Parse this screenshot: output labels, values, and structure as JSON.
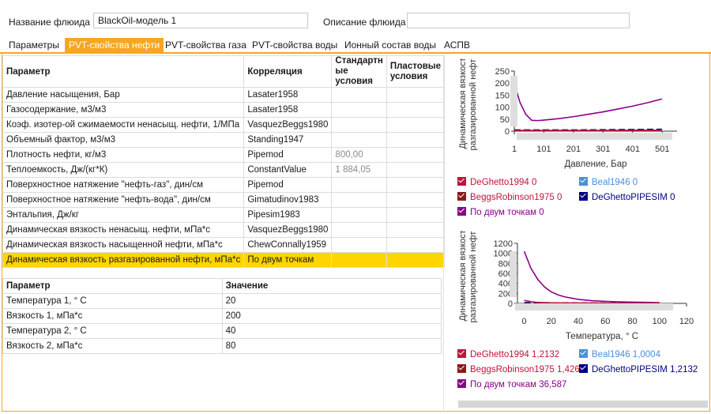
{
  "header": {
    "fluid_name_label": "Название флюида",
    "fluid_name_value": "BlackOil-модель 1",
    "fluid_desc_label": "Описание флюида",
    "fluid_desc_value": ""
  },
  "tabs": [
    "Параметры",
    "PVT-свойства нефти",
    "PVT-свойства газа",
    "PVT-свойства воды",
    "Ионный состав воды",
    "АСПВ"
  ],
  "corr_table": {
    "headers": {
      "param": "Параметр",
      "corr": "Корреляция",
      "std": "Стандартн ые условия",
      "res": "Пластовые условия"
    },
    "rows": [
      {
        "param": "Давление насыщения, Бар",
        "corr": "Lasater1958",
        "std": "",
        "res": ""
      },
      {
        "param": "Газосодержание, м3/м3",
        "corr": "Lasater1958",
        "std": "",
        "res": ""
      },
      {
        "param": "Коэф. изотер-ой сжимаемости ненасыщ. нефти, 1/МПа",
        "corr": "VasquezBeggs1980",
        "std": "",
        "res": ""
      },
      {
        "param": "Объемный фактор, м3/м3",
        "corr": "Standing1947",
        "std": "",
        "res": ""
      },
      {
        "param": "Плотность нефти, кг/м3",
        "corr": "Pipemod",
        "std": "800,00",
        "res": ""
      },
      {
        "param": "Теплоемкость, Дж/(кг*К)",
        "corr": "ConstantValue",
        "std": "1 884,05",
        "res": ""
      },
      {
        "param": "Поверхностное натяжение \"нефть-газ\", дин/см",
        "corr": "Pipemod",
        "std": "",
        "res": ""
      },
      {
        "param": "Поверхностное натяжение \"нефть-вода\", дин/см",
        "corr": "Gimatudinov1983",
        "std": "",
        "res": ""
      },
      {
        "param": "Энтальпия, Дж/кг",
        "corr": "Pipesim1983",
        "std": "",
        "res": ""
      },
      {
        "param": "Динамическая вязкость ненасыщ. нефти, мПа*с",
        "corr": "VasquezBeggs1980",
        "std": "",
        "res": ""
      },
      {
        "param": "Динамическая вязкость насыщенной нефти, мПа*с",
        "corr": "ChewConnally1959",
        "std": "",
        "res": ""
      },
      {
        "param": "Динамическая вязкость разгазированной нефти, мПа*с",
        "corr": "По двум точкам",
        "std": "",
        "res": ""
      }
    ]
  },
  "value_table": {
    "headers": {
      "param": "Параметр",
      "value": "Значение"
    },
    "rows": [
      {
        "param": "Температура 1, ° C",
        "value": "20"
      },
      {
        "param": "Вязкость 1, мПа*с",
        "value": "200"
      },
      {
        "param": "Температура 2, ° C",
        "value": "40"
      },
      {
        "param": "Вязкость 2, мПа*с",
        "value": "80"
      }
    ]
  },
  "colors": {
    "accent": "#f5a623",
    "highlight": "#ffd500",
    "deghetto": "#c0143c",
    "beggs": "#8b1a1a",
    "beal": "#4a90d9",
    "pipesim": "#000080",
    "two_points": "#8b008b"
  },
  "chart_data": [
    {
      "type": "line",
      "ylabel": "Динамическая вязкость разгазированной нефти,",
      "xlabel": "Давление, Бар",
      "xticks": [
        "1",
        "101",
        "201",
        "301",
        "401",
        "501"
      ],
      "yticks": [
        "0",
        "50",
        "100",
        "150",
        "200",
        "250"
      ],
      "xlim": [
        1,
        551
      ],
      "ylim": [
        0,
        250
      ],
      "series": [
        {
          "name": "По двум точкам",
          "color": "#8b008b",
          "dash": false,
          "x": [
            1,
            20,
            40,
            60,
            80,
            100,
            150,
            200,
            250,
            300,
            350,
            400,
            450,
            500
          ],
          "y": [
            200,
            120,
            70,
            45,
            44,
            46,
            52,
            60,
            70,
            80,
            92,
            104,
            118,
            134
          ]
        },
        {
          "name": "DeGhettoPIPESIM",
          "color": "#000080",
          "dash": true,
          "x": [
            1,
            100,
            200,
            300,
            400,
            500
          ],
          "y": [
            5,
            5,
            5,
            6,
            7,
            8
          ]
        },
        {
          "name": "DeGhetto1994",
          "color": "#c0143c",
          "dash": false,
          "x": [
            1,
            100,
            200,
            300,
            400,
            500
          ],
          "y": [
            3,
            3,
            3,
            3,
            4,
            4
          ]
        }
      ],
      "legend": [
        {
          "name": "DeGhetto1994",
          "value": "0",
          "color": "#c0143c",
          "text_color": "#c0143c"
        },
        {
          "name": "Beal1946",
          "value": "0",
          "color": "#4a90d9",
          "text_color": "#4a90d9"
        },
        {
          "name": "BeggsRobinson1975",
          "value": "0",
          "color": "#8b1a1a",
          "text_color": "#c0143c"
        },
        {
          "name": "DeGhettoPIPESIM",
          "value": "0",
          "color": "#000080",
          "text_color": "#000080"
        },
        {
          "name": "По двум точкам",
          "value": "0",
          "color": "#8b008b",
          "text_color": "#8b008b"
        }
      ]
    },
    {
      "type": "line",
      "ylabel": "Динамическая вязкость разгазированной нефти,",
      "xlabel": "Температура, ° С",
      "xticks": [
        "0",
        "20",
        "40",
        "60",
        "80",
        "100",
        "120"
      ],
      "yticks": [
        "0",
        "200",
        "400",
        "600",
        "800",
        "1000",
        "1200"
      ],
      "xlim": [
        -5,
        120
      ],
      "ylim": [
        0,
        1200
      ],
      "series": [
        {
          "name": "По двум точкам",
          "color": "#8b008b",
          "dash": false,
          "x": [
            0,
            5,
            10,
            15,
            20,
            25,
            30,
            40,
            50,
            60,
            70,
            80,
            90,
            100
          ],
          "y": [
            1040,
            700,
            480,
            330,
            230,
            170,
            130,
            80,
            55,
            40,
            30,
            25,
            20,
            15
          ]
        },
        {
          "name": "DeGhettoPIPESIM",
          "color": "#000080",
          "dash": true,
          "x": [
            0,
            20,
            40,
            60,
            80,
            100
          ],
          "y": [
            15,
            12,
            10,
            8,
            7,
            6
          ]
        },
        {
          "name": "DeGhetto1994",
          "color": "#c0143c",
          "dash": false,
          "x": [
            0,
            5,
            10,
            20,
            40,
            60,
            80,
            100
          ],
          "y": [
            60,
            35,
            20,
            12,
            8,
            6,
            5,
            5
          ]
        }
      ],
      "legend": [
        {
          "name": "DeGhetto1994",
          "value": "1,2132",
          "color": "#c0143c",
          "text_color": "#c0143c"
        },
        {
          "name": "Beal1946",
          "value": "1,0004",
          "color": "#4a90d9",
          "text_color": "#4a90d9"
        },
        {
          "name": "BeggsRobinson1975",
          "value": "1,426",
          "color": "#8b1a1a",
          "text_color": "#c0143c"
        },
        {
          "name": "DeGhettoPIPESIM",
          "value": "1,2132",
          "color": "#000080",
          "text_color": "#000080"
        },
        {
          "name": "По двум точкам",
          "value": "36,587",
          "color": "#8b008b",
          "text_color": "#8b008b"
        }
      ]
    }
  ]
}
